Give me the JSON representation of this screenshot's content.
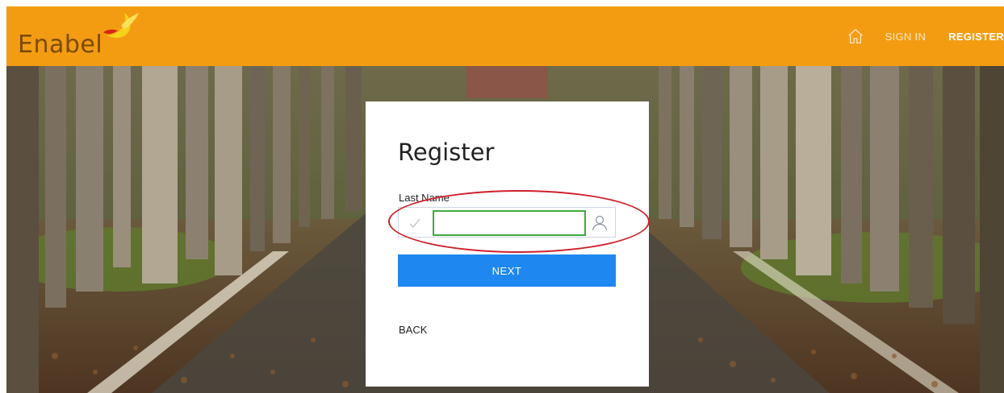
{
  "header": {
    "logo_text": "Enabel",
    "nav": {
      "home_icon": "home-icon",
      "sign_in_label": "SIGN IN",
      "register_label": "REGISTER"
    }
  },
  "form": {
    "title": "Register",
    "last_name_label": "Last Name",
    "last_name_value": "",
    "last_name_placeholder": "",
    "next_label": "NEXT",
    "back_label": "BACK"
  },
  "colors": {
    "header_bg": "#f39c12",
    "logo_text": "#7a4a08",
    "next_button": "#1e88f0",
    "input_focus_border": "#3cab3c",
    "annotation": "#d0202a"
  }
}
